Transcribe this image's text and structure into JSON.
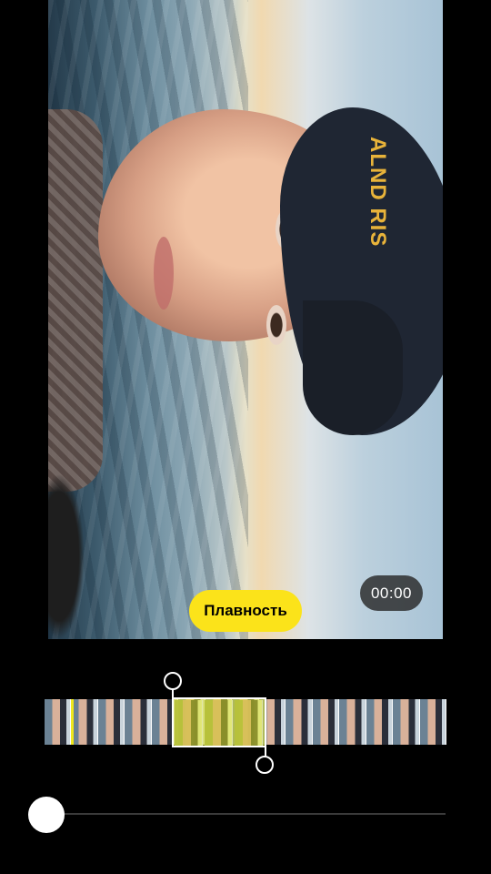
{
  "preview": {
    "timer": "00:00",
    "smoothness_button": "Плавность",
    "cap_text": "ALND RIS"
  },
  "timeline": {
    "frame_count": 15,
    "selection_start_fraction": 0.32,
    "selection_end_fraction": 0.55
  },
  "scrubber": {
    "position_fraction": 0.0
  },
  "colors": {
    "accent_yellow": "#fbe31a",
    "background": "#000000",
    "selection_tint": "#e6e828"
  },
  "icons": {
    "start_handle": "circle-handle-icon",
    "end_handle": "circle-handle-icon"
  }
}
